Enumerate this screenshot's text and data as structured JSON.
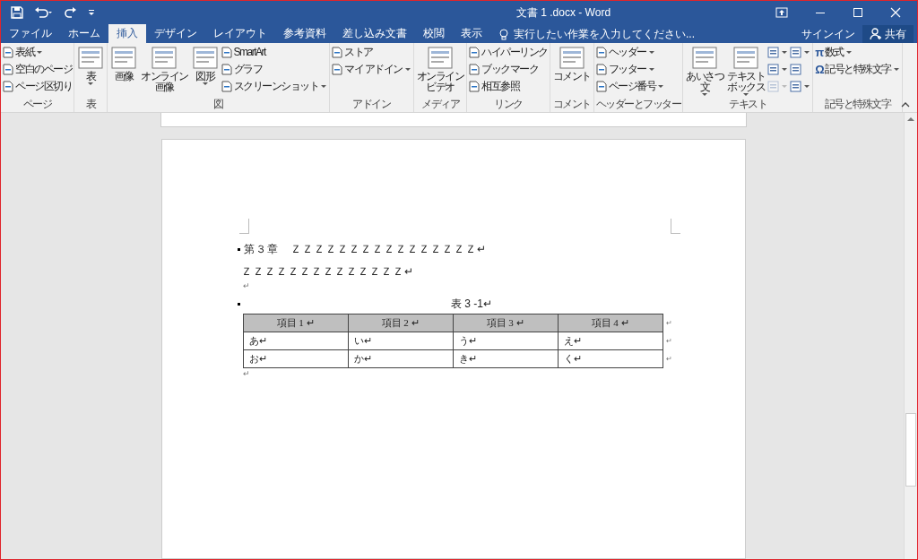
{
  "window": {
    "title": "文書 1 .docx - Word"
  },
  "tabs": [
    {
      "label": "ファイル",
      "selected": false
    },
    {
      "label": "ホーム",
      "selected": false
    },
    {
      "label": "挿入",
      "selected": true
    },
    {
      "label": "デザイン",
      "selected": false
    },
    {
      "label": "レイアウト",
      "selected": false
    },
    {
      "label": "参考資料",
      "selected": false
    },
    {
      "label": "差し込み文書",
      "selected": false
    },
    {
      "label": "校閲",
      "selected": false
    },
    {
      "label": "表示",
      "selected": false
    }
  ],
  "tell_me": {
    "placeholder": "実行したい作業を入力してください..."
  },
  "sign_in": "サインイン",
  "share": "共有",
  "ribbon": [
    {
      "label": "ページ",
      "columns": [
        [
          {
            "kind": "small",
            "label": "表紙",
            "dropdown": true
          },
          {
            "kind": "small",
            "label": "空白のページ",
            "dropdown": false
          },
          {
            "kind": "small",
            "label": "ページ区切り",
            "dropdown": false
          }
        ]
      ]
    },
    {
      "label": "表",
      "columns": [
        [
          {
            "kind": "large",
            "lines": [
              "表"
            ],
            "dropdown": true
          }
        ]
      ]
    },
    {
      "label": "図",
      "columns": [
        [
          {
            "kind": "large",
            "lines": [
              "画像"
            ],
            "dropdown": false
          }
        ],
        [
          {
            "kind": "large",
            "lines": [
              "オンライン",
              "画像"
            ],
            "dropdown": false
          }
        ],
        [
          {
            "kind": "large",
            "lines": [
              "図形"
            ],
            "dropdown": true
          }
        ],
        [
          {
            "kind": "small",
            "label": "SmartArt",
            "dropdown": false
          },
          {
            "kind": "small",
            "label": "グラフ",
            "dropdown": false
          },
          {
            "kind": "small",
            "label": "スクリーンショット",
            "dropdown": true
          }
        ]
      ]
    },
    {
      "label": "アドイン",
      "columns": [
        [
          {
            "kind": "small",
            "label": "ストア",
            "dropdown": false
          },
          {
            "kind": "small",
            "label": "マイ アドイン",
            "dropdown": true
          }
        ]
      ]
    },
    {
      "label": "メディア",
      "columns": [
        [
          {
            "kind": "large",
            "lines": [
              "オンライン",
              "ビデオ"
            ],
            "dropdown": false
          }
        ]
      ]
    },
    {
      "label": "リンク",
      "columns": [
        [
          {
            "kind": "small",
            "label": "ハイパーリンク",
            "dropdown": false
          },
          {
            "kind": "small",
            "label": "ブックマーク",
            "dropdown": false
          },
          {
            "kind": "small",
            "label": "相互参照",
            "dropdown": false
          }
        ]
      ]
    },
    {
      "label": "コメント",
      "columns": [
        [
          {
            "kind": "large",
            "lines": [
              "コメント"
            ],
            "dropdown": false
          }
        ]
      ]
    },
    {
      "label": "ヘッダーとフッター",
      "columns": [
        [
          {
            "kind": "small",
            "label": "ヘッダー",
            "dropdown": true
          },
          {
            "kind": "small",
            "label": "フッター",
            "dropdown": true
          },
          {
            "kind": "small",
            "label": "ページ番号",
            "dropdown": true
          }
        ]
      ]
    },
    {
      "label": "テキスト",
      "columns": [
        [
          {
            "kind": "large",
            "lines": [
              "あいさつ",
              "文"
            ],
            "dropdown": true
          }
        ],
        [
          {
            "kind": "large",
            "lines": [
              "テキスト",
              "ボックス"
            ],
            "dropdown": true
          }
        ],
        [
          {
            "kind": "icon",
            "dropdown": true,
            "disabled": false
          },
          {
            "kind": "icon",
            "dropdown": true,
            "disabled": false
          },
          {
            "kind": "icon",
            "dropdown": true,
            "disabled": true
          }
        ],
        [
          {
            "kind": "icon",
            "dropdown": true,
            "disabled": false
          },
          {
            "kind": "icon",
            "dropdown": false,
            "disabled": false
          },
          {
            "kind": "icon",
            "dropdown": true,
            "disabled": false
          }
        ]
      ]
    },
    {
      "label": "記号と特殊文字",
      "columns": [
        [
          {
            "kind": "glyph",
            "glyph": "π",
            "label": "数式",
            "dropdown": true
          },
          {
            "kind": "glyph",
            "glyph": "Ω",
            "label": "記号と特殊文字",
            "dropdown": true
          }
        ]
      ]
    }
  ],
  "document": {
    "paragraphs": [
      {
        "kind": "text",
        "text": "第３章　ＺＺＺＺＺＺＺＺＺＺＺＺＺＺＺＺ↵",
        "mark": true
      },
      {
        "kind": "text",
        "text": "ＺＺＺＺＺＺＺＺＺＺＺＺＺＺ↵",
        "mark": false
      },
      {
        "kind": "empty",
        "text": "↵"
      },
      {
        "kind": "caption",
        "text": "表  3 -1↵",
        "mark": true
      },
      {
        "kind": "table",
        "columns": [
          "項目 1 ↵",
          "項目 2 ↵",
          "項目 3 ↵",
          "項目 4 ↵"
        ],
        "header_end": "↵",
        "rows": [
          {
            "cells": [
              "あ↵",
              "い↵",
              "う↵",
              "え↵"
            ],
            "end": "↵"
          },
          {
            "cells": [
              "お↵",
              "か↵",
              "き↵",
              "く↵"
            ],
            "end": "↵"
          }
        ]
      },
      {
        "kind": "empty",
        "text": "↵"
      }
    ]
  }
}
